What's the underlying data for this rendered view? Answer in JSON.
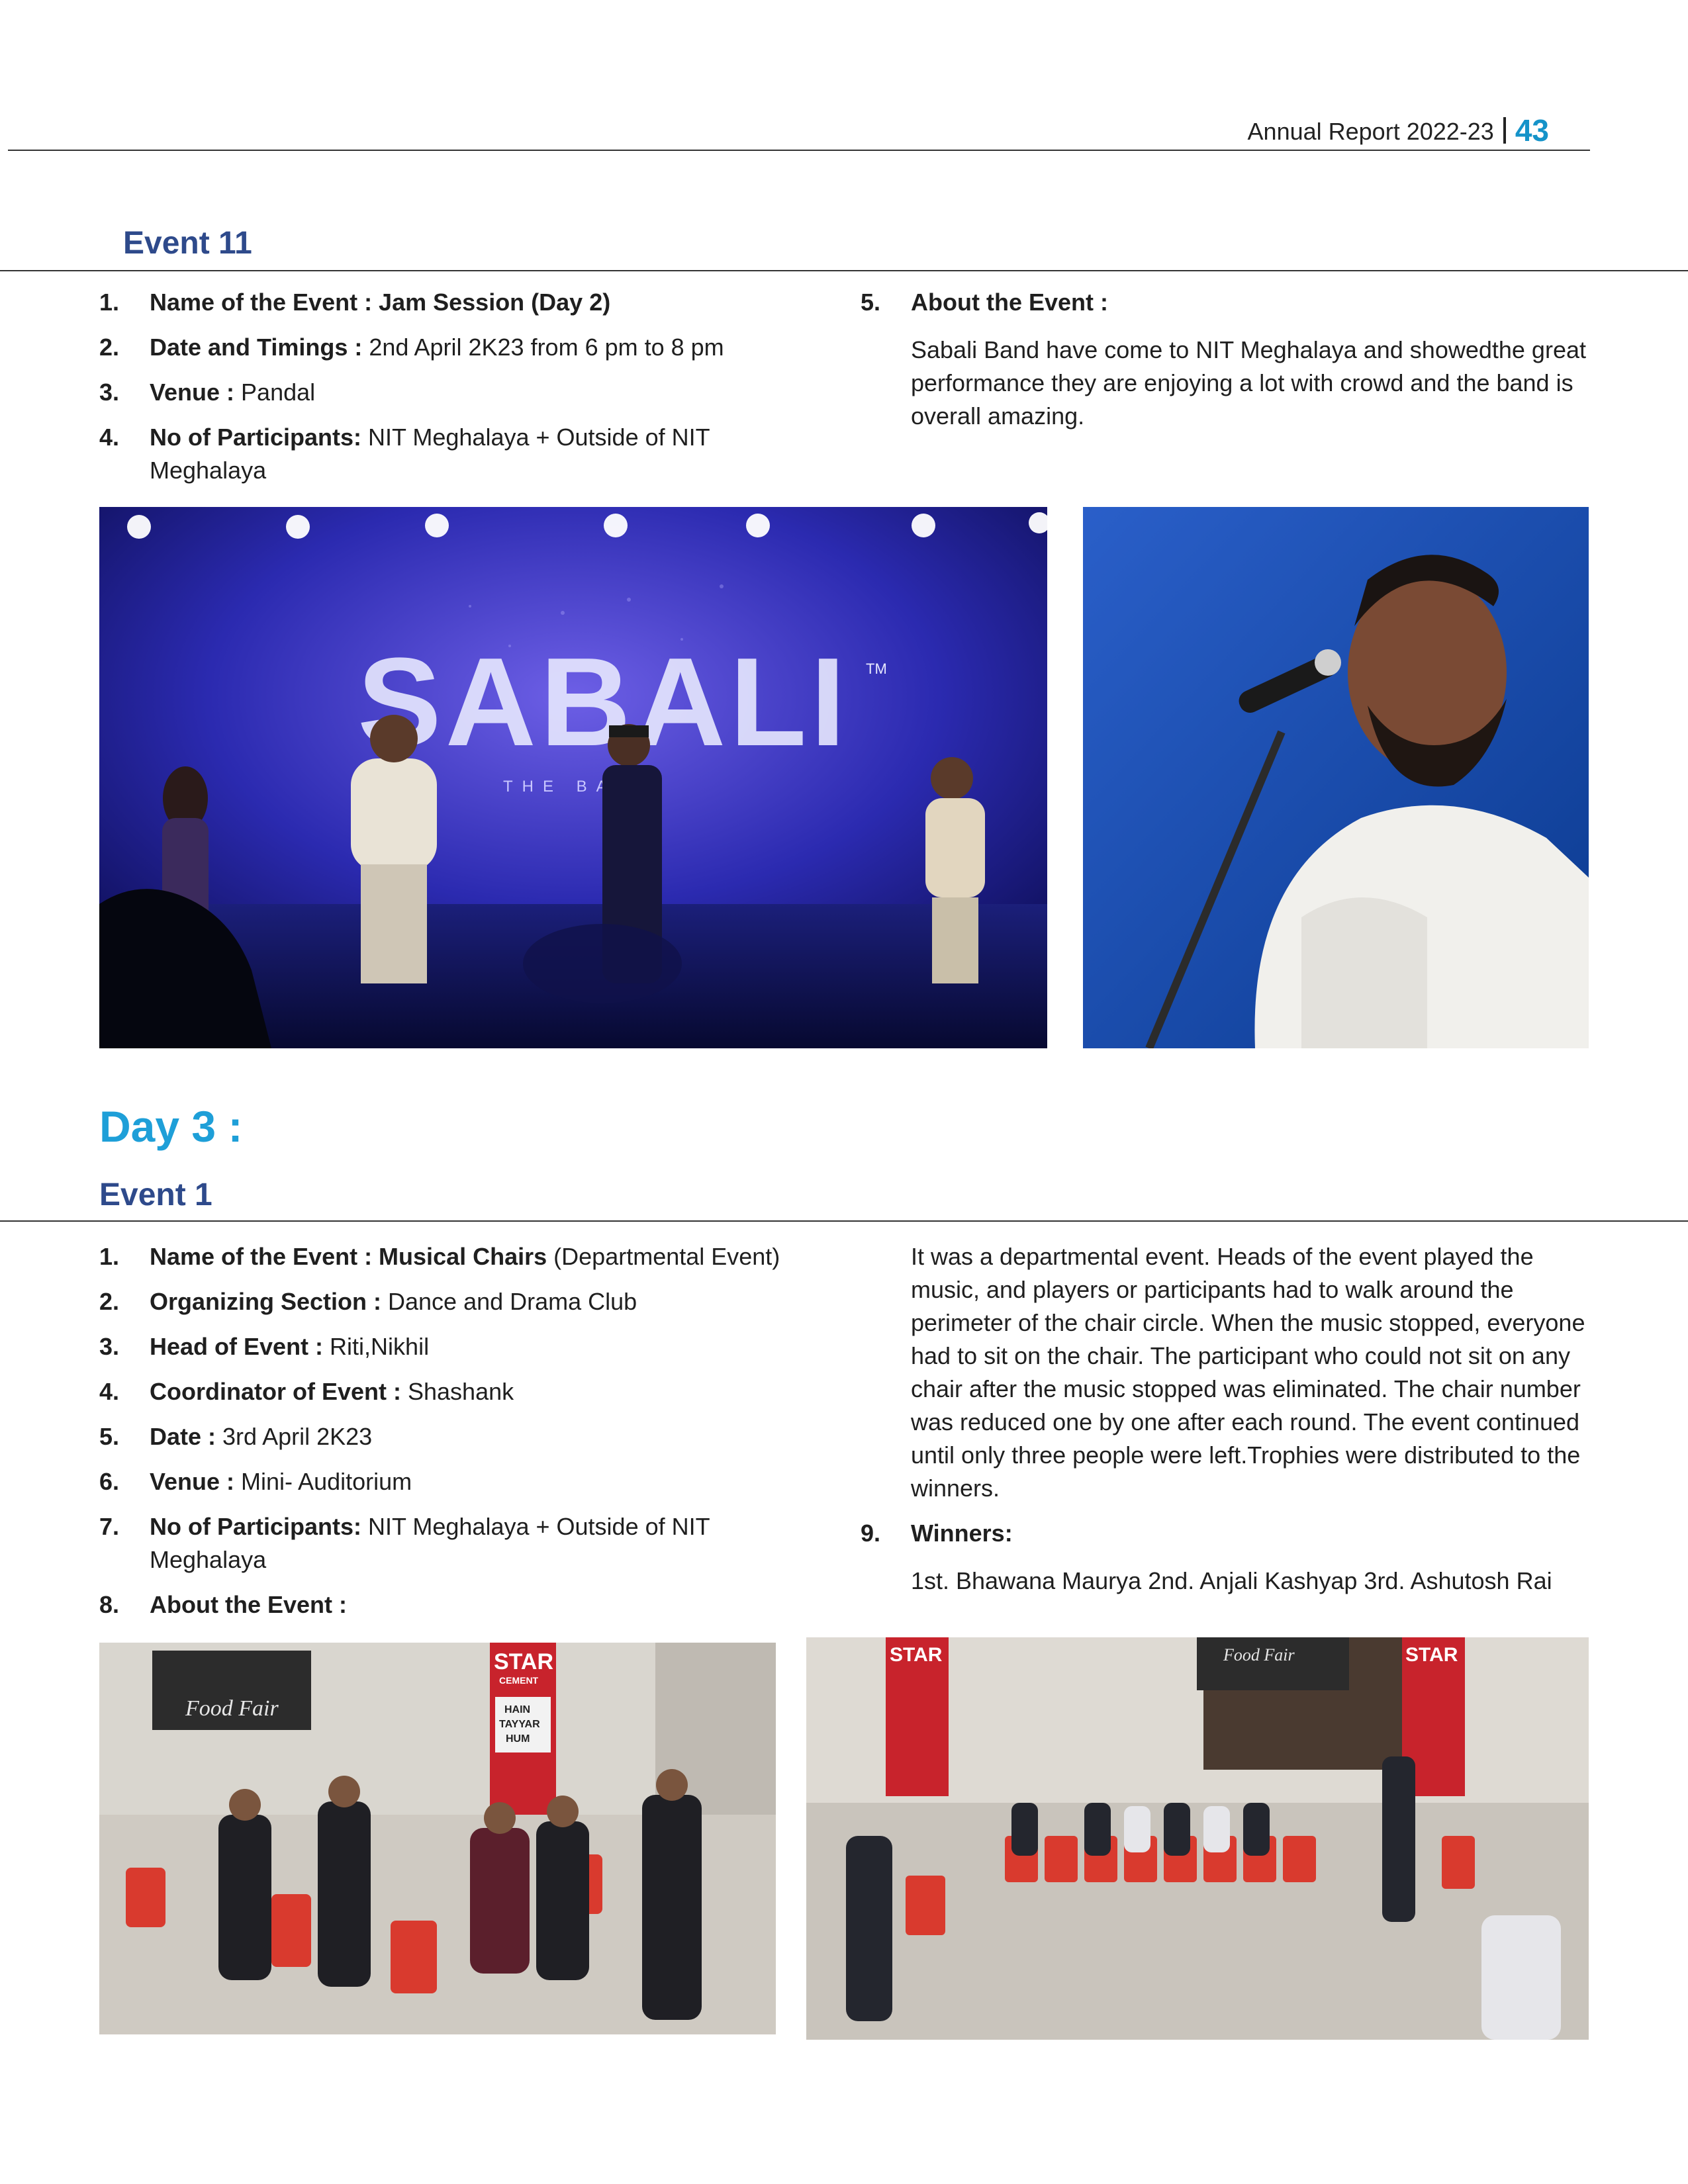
{
  "header": {
    "title": "Annual Report 2022-23",
    "page_number": "43"
  },
  "event11": {
    "title": "Event 11",
    "items": [
      {
        "num": "1.",
        "label": "Name of the Event : Jam Session (Day 2)",
        "value": ""
      },
      {
        "num": "2.",
        "label": "Date and Timings :",
        "value": " 2nd April 2K23 from 6 pm to 8 pm"
      },
      {
        "num": "3.",
        "label": "Venue :",
        "value": " Pandal"
      },
      {
        "num": "4.",
        "label": "No of Participants:",
        "value": " NIT Meghalaya + Outside of NIT Meghalaya"
      }
    ],
    "about": {
      "num": "5.",
      "label": "About the Event :",
      "text": "Sabali Band have come to NIT Meghalaya and showedthe great performance they are enjoying a lot with crowd and the band is overall amazing."
    },
    "photo_left": {
      "sign": "SABALI",
      "sign_sub": "THE BAND",
      "tm": "TM"
    }
  },
  "day3": {
    "title": "Day 3 :",
    "event1": {
      "title": "Event 1",
      "items": [
        {
          "num": "1.",
          "label": "Name of the Event : Musical Chairs",
          "value": " (Departmental Event)"
        },
        {
          "num": "2.",
          "label": "Organizing Section :",
          "value": " Dance and Drama Club"
        },
        {
          "num": "3.",
          "label": "Head of Event :",
          "value": " Riti,Nikhil"
        },
        {
          "num": "4.",
          "label": "Coordinator of Event :",
          "value": " Shashank"
        },
        {
          "num": "5.",
          "label": "Date :",
          "value": " 3rd April 2K23"
        },
        {
          "num": "6.",
          "label": "Venue :",
          "value": " Mini- Auditorium"
        },
        {
          "num": "7.",
          "label": "No of Participants:",
          "value": " NIT Meghalaya + Outside of NIT Meghalaya"
        },
        {
          "num": "8.",
          "label": "About the Event :",
          "value": ""
        }
      ],
      "about_text": "It was a departmental event. Heads of the event played the music, and players or participants had to walk around the perimeter of the chair circle. When the music stopped, everyone had to sit on the chair. The participant who could not sit on any chair after the music stopped was eliminated. The chair number was reduced one by one after each round. The event continued until only three people were left.Trophies were distributed to the winners.",
      "winners": {
        "num": "9.",
        "label": "Winners:",
        "text": "1st. Bhawana Maurya 2nd. Anjali Kashyap 3rd. Ashutosh Rai"
      },
      "photo_banner": {
        "brand": "STAR",
        "brand_sub": "CEMENT",
        "slogan_1": "HAIN",
        "slogan_2": "TAYYAR",
        "slogan_3": "HUM",
        "food_fair": "Food Fair"
      }
    }
  },
  "colors": {
    "accent_blue": "#1593c9",
    "heading_navy": "#2e4a8b",
    "day_blue": "#1e9fd8"
  }
}
